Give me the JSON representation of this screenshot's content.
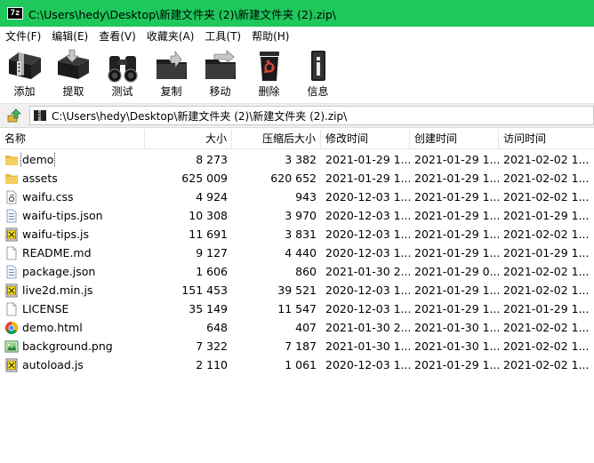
{
  "window": {
    "app_icon_text": "7z",
    "title": "C:\\Users\\hedy\\Desktop\\新建文件夹 (2)\\新建文件夹 (2).zip\\"
  },
  "menu": [
    {
      "label": "文件(F)"
    },
    {
      "label": "编辑(E)"
    },
    {
      "label": "查看(V)"
    },
    {
      "label": "收藏夹(A)"
    },
    {
      "label": "工具(T)"
    },
    {
      "label": "帮助(H)"
    }
  ],
  "toolbar": [
    {
      "label": "添加",
      "icon": "add-icon"
    },
    {
      "label": "提取",
      "icon": "extract-icon"
    },
    {
      "label": "测试",
      "icon": "test-icon"
    },
    {
      "label": "复制",
      "icon": "copy-icon"
    },
    {
      "label": "移动",
      "icon": "move-icon"
    },
    {
      "label": "删除",
      "icon": "delete-icon"
    },
    {
      "label": "信息",
      "icon": "info-icon"
    }
  ],
  "address": {
    "path": "C:\\Users\\hedy\\Desktop\\新建文件夹 (2)\\新建文件夹 (2).zip\\"
  },
  "columns": {
    "name": "名称",
    "size": "大小",
    "packed": "压缩后大小",
    "modified": "修改时间",
    "created": "创建时间",
    "accessed": "访问时间"
  },
  "files": [
    {
      "name": "demo",
      "icon": "folder-icon",
      "size": "8 273",
      "packed": "3 382",
      "modified": "2021-01-29 1...",
      "created": "2021-01-29 1...",
      "accessed": "2021-02-02 1..."
    },
    {
      "name": "assets",
      "icon": "folder-icon",
      "size": "625 009",
      "packed": "620 652",
      "modified": "2021-01-29 1...",
      "created": "2021-01-29 1...",
      "accessed": "2021-02-02 1..."
    },
    {
      "name": "waifu.css",
      "icon": "css-file-icon",
      "size": "4 924",
      "packed": "943",
      "modified": "2020-12-03 1...",
      "created": "2021-01-29 1...",
      "accessed": "2021-02-02 1..."
    },
    {
      "name": "waifu-tips.json",
      "icon": "json-file-icon",
      "size": "10 308",
      "packed": "3 970",
      "modified": "2020-12-03 1...",
      "created": "2021-01-29 1...",
      "accessed": "2021-01-29 1..."
    },
    {
      "name": "waifu-tips.js",
      "icon": "js-file-icon",
      "size": "11 691",
      "packed": "3 831",
      "modified": "2020-12-03 1...",
      "created": "2021-01-29 1...",
      "accessed": "2021-02-02 1..."
    },
    {
      "name": "README.md",
      "icon": "text-file-icon",
      "size": "9 127",
      "packed": "4 440",
      "modified": "2020-12-03 1...",
      "created": "2021-01-29 1...",
      "accessed": "2021-01-29 1..."
    },
    {
      "name": "package.json",
      "icon": "json-file-icon",
      "size": "1 606",
      "packed": "860",
      "modified": "2021-01-30 2...",
      "created": "2021-01-29 0...",
      "accessed": "2021-02-02 1..."
    },
    {
      "name": "live2d.min.js",
      "icon": "js-file-icon",
      "size": "151 453",
      "packed": "39 521",
      "modified": "2020-12-03 1...",
      "created": "2021-01-29 1...",
      "accessed": "2021-02-02 1..."
    },
    {
      "name": "LICENSE",
      "icon": "text-file-icon",
      "size": "35 149",
      "packed": "11 547",
      "modified": "2020-12-03 1...",
      "created": "2021-01-29 1...",
      "accessed": "2021-01-29 1..."
    },
    {
      "name": "demo.html",
      "icon": "chrome-html-icon",
      "size": "648",
      "packed": "407",
      "modified": "2021-01-30 2...",
      "created": "2021-01-30 1...",
      "accessed": "2021-02-02 1..."
    },
    {
      "name": "background.png",
      "icon": "image-file-icon",
      "size": "7 322",
      "packed": "7 187",
      "modified": "2021-01-30 1...",
      "created": "2021-01-30 1...",
      "accessed": "2021-02-02 1..."
    },
    {
      "name": "autoload.js",
      "icon": "js-file-icon",
      "size": "2 110",
      "packed": "1 061",
      "modified": "2020-12-03 1...",
      "created": "2021-01-29 1...",
      "accessed": "2021-02-02 1..."
    }
  ],
  "colors": {
    "titlebar": "#1ec85b",
    "folder": "#f2c94c"
  }
}
